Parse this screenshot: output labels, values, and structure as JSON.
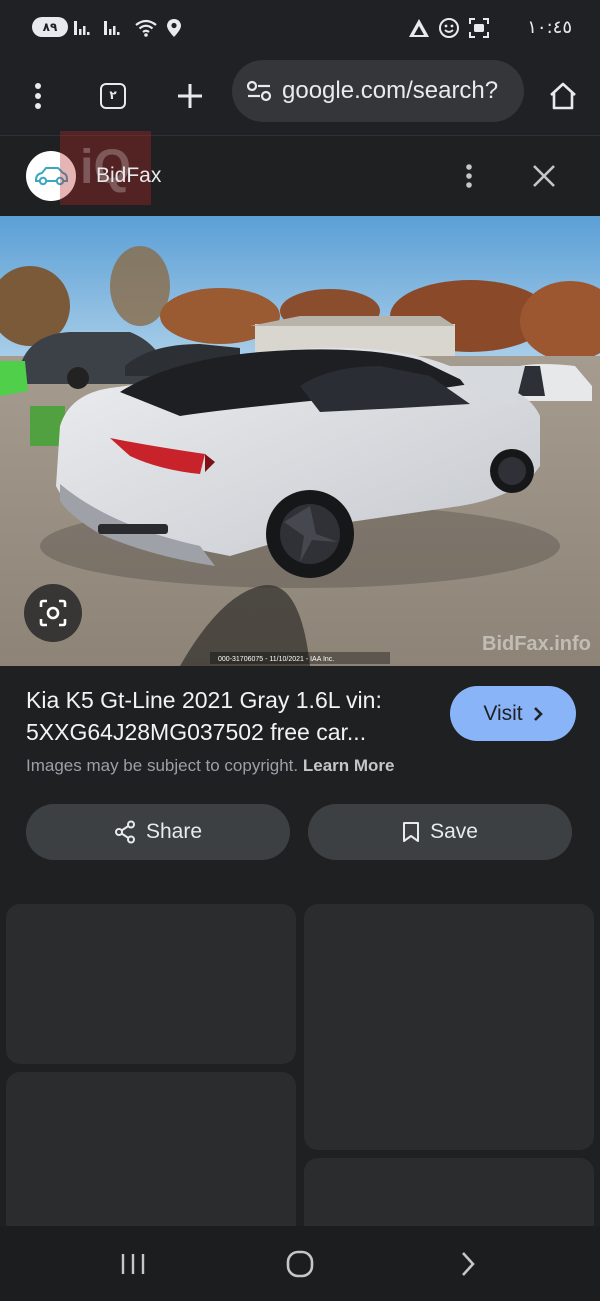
{
  "status_bar": {
    "battery": "٨٩",
    "time": "١٠:٤٥"
  },
  "toolbar": {
    "tab_count": "٢",
    "url": "google.com/search?",
    "icons": [
      "more-vert-icon",
      "tab-switcher-icon",
      "plus-icon",
      "site-settings-icon",
      "home-icon"
    ]
  },
  "site": {
    "name": "BidFax",
    "icons": [
      "car-logo-icon",
      "more-vert-icon",
      "close-icon"
    ]
  },
  "image": {
    "watermark": "BidFax.info",
    "caption": "000-31706075 - 11/10/2021 - IAA Inc."
  },
  "result": {
    "title": "Kia K5 Gt-Line 2021 Gray 1.6L vin: 5XXG64J28MG037502 free car...",
    "visit_label": "Visit",
    "copyright_text": "Images may be subject to copyright.",
    "learn_more": "Learn More"
  },
  "actions": {
    "share_label": "Share",
    "save_label": "Save"
  },
  "colors": {
    "background": "#1f2021",
    "accent": "#8ab4f8",
    "button": "#3c4043",
    "card": "#2b2c2e"
  }
}
